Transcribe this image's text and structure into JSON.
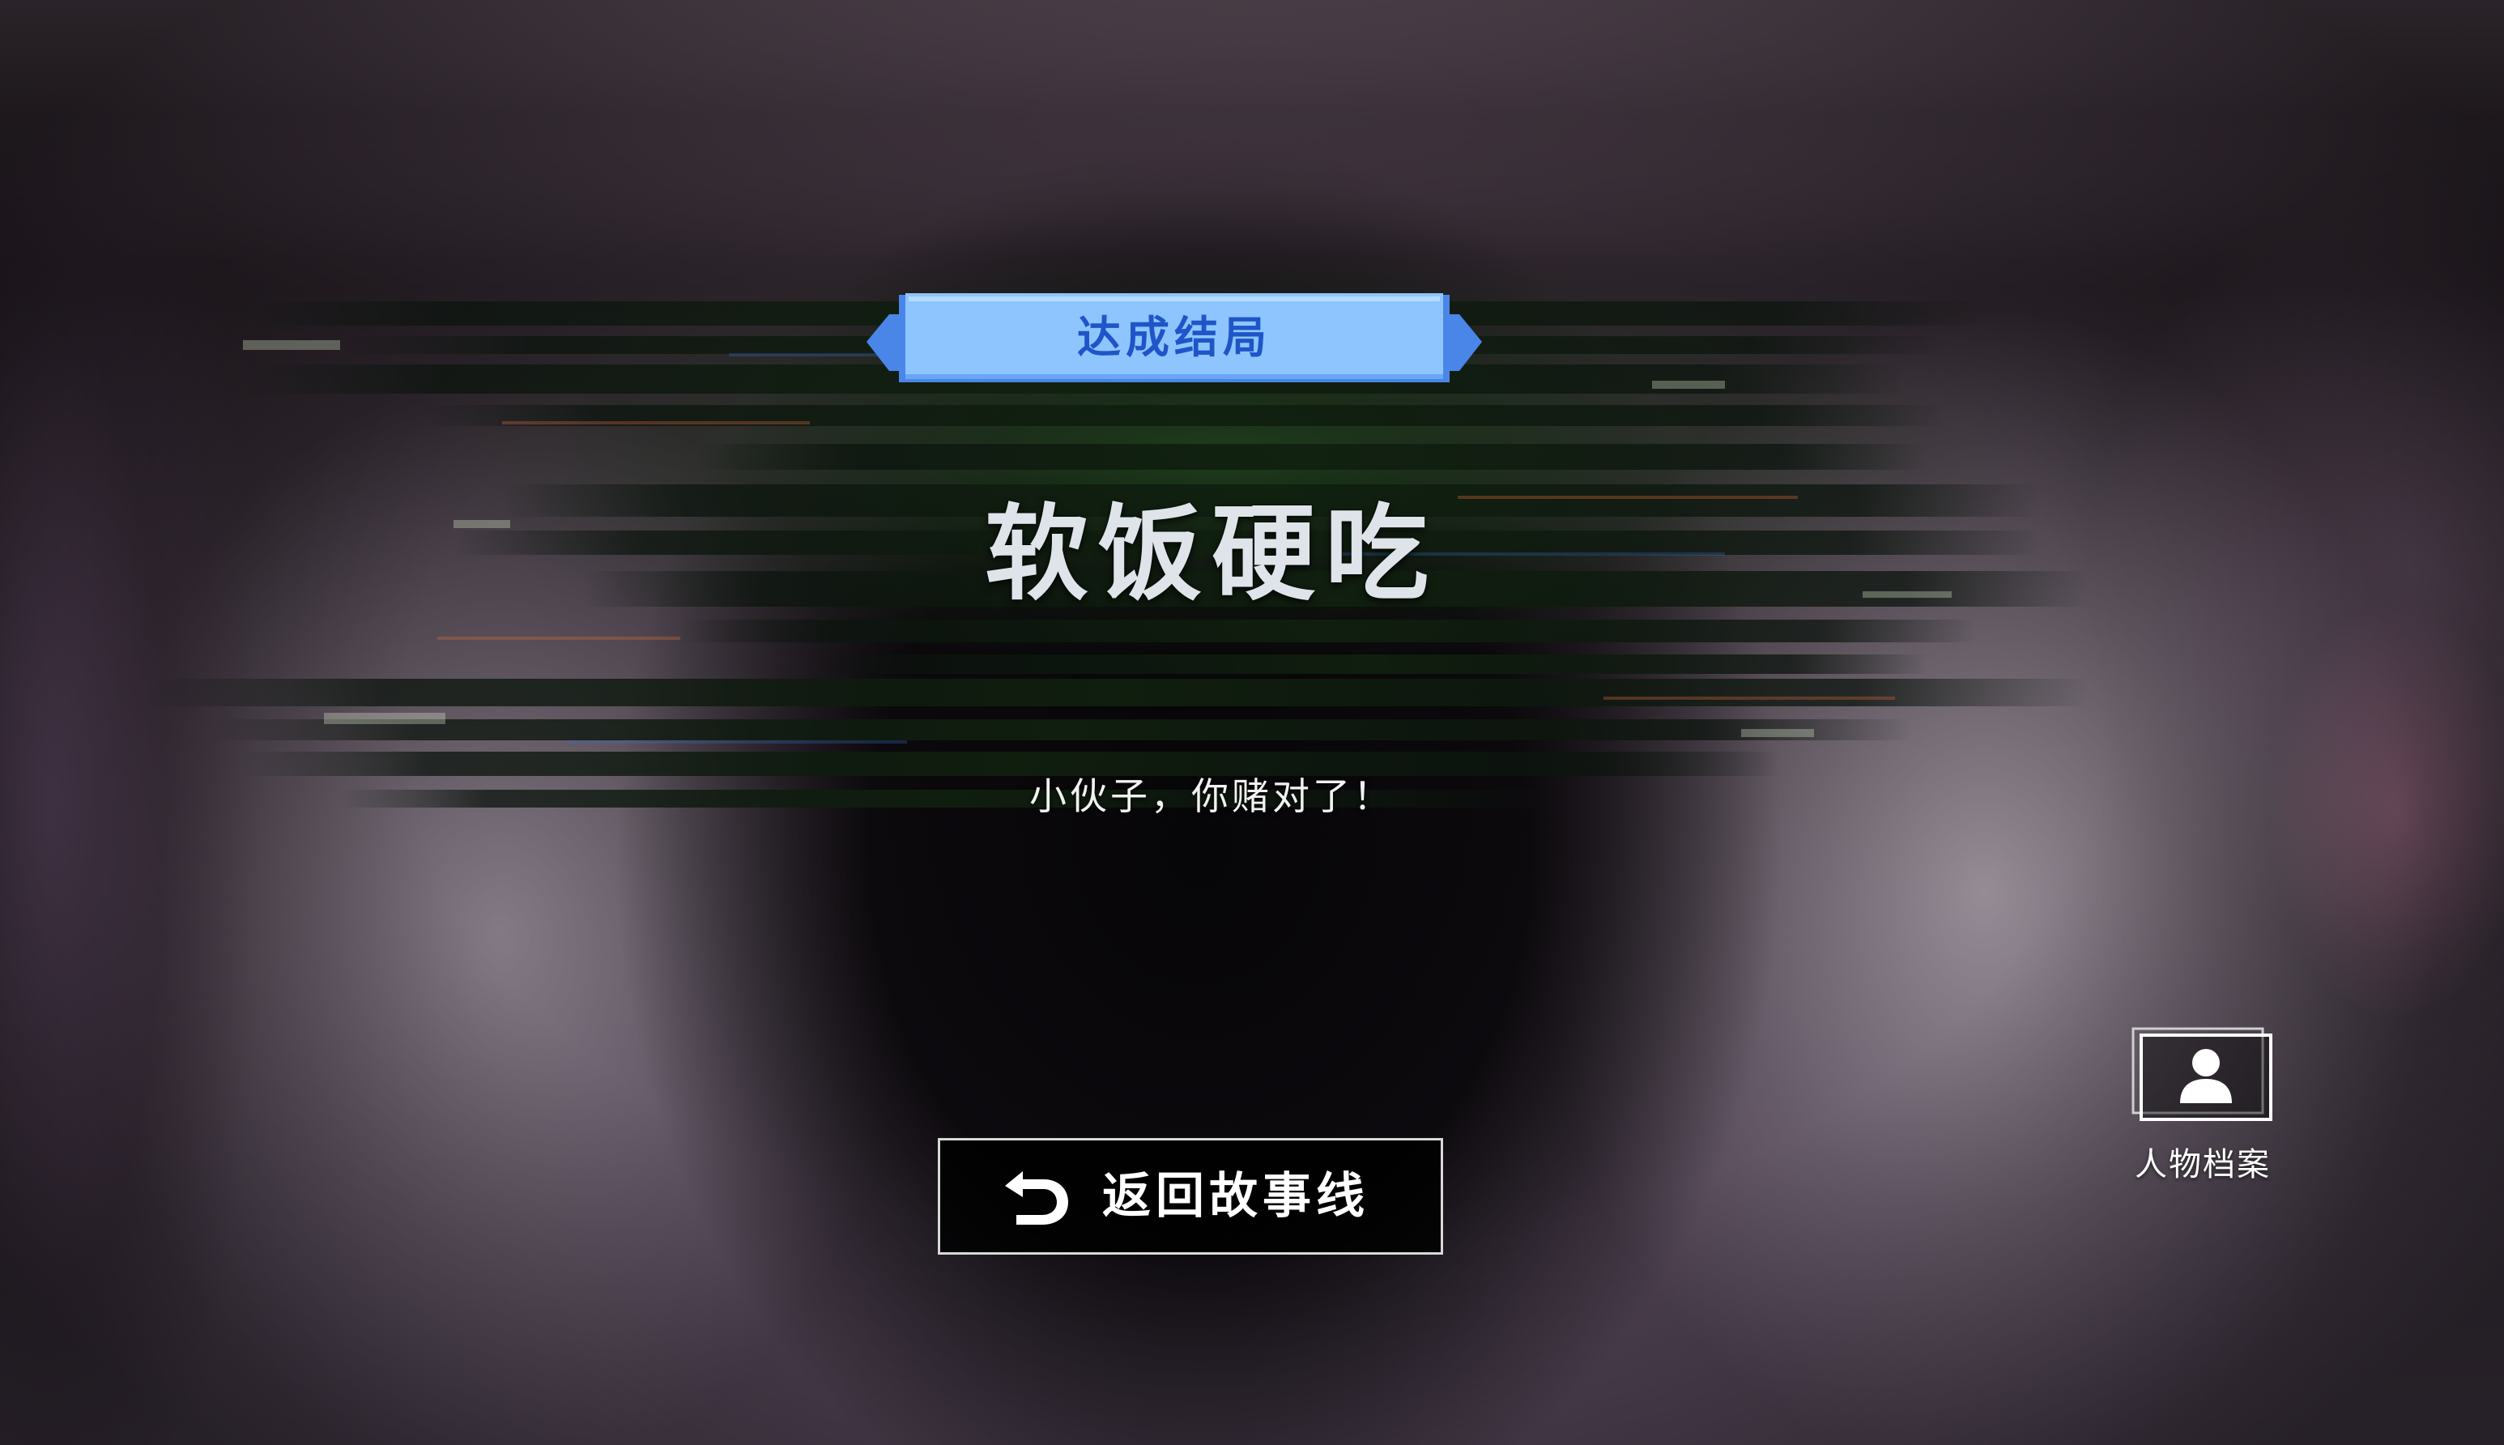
{
  "ending": {
    "banner_label": "达成结局",
    "title": "软饭硬吃",
    "subtitle": "小伙子，你赌对了！"
  },
  "actions": {
    "return_label": "返回故事线",
    "return_icon": "undo-arrow-icon",
    "profile_label": "人物档案",
    "profile_icon": "character-profile-icon"
  },
  "colors": {
    "banner_fill": "#8ec5ff",
    "banner_border": "#4a86e8",
    "banner_text": "#1f55c8",
    "button_background": "#0a0a0a",
    "button_border": "#d8d8d8",
    "text": "#ffffff"
  }
}
